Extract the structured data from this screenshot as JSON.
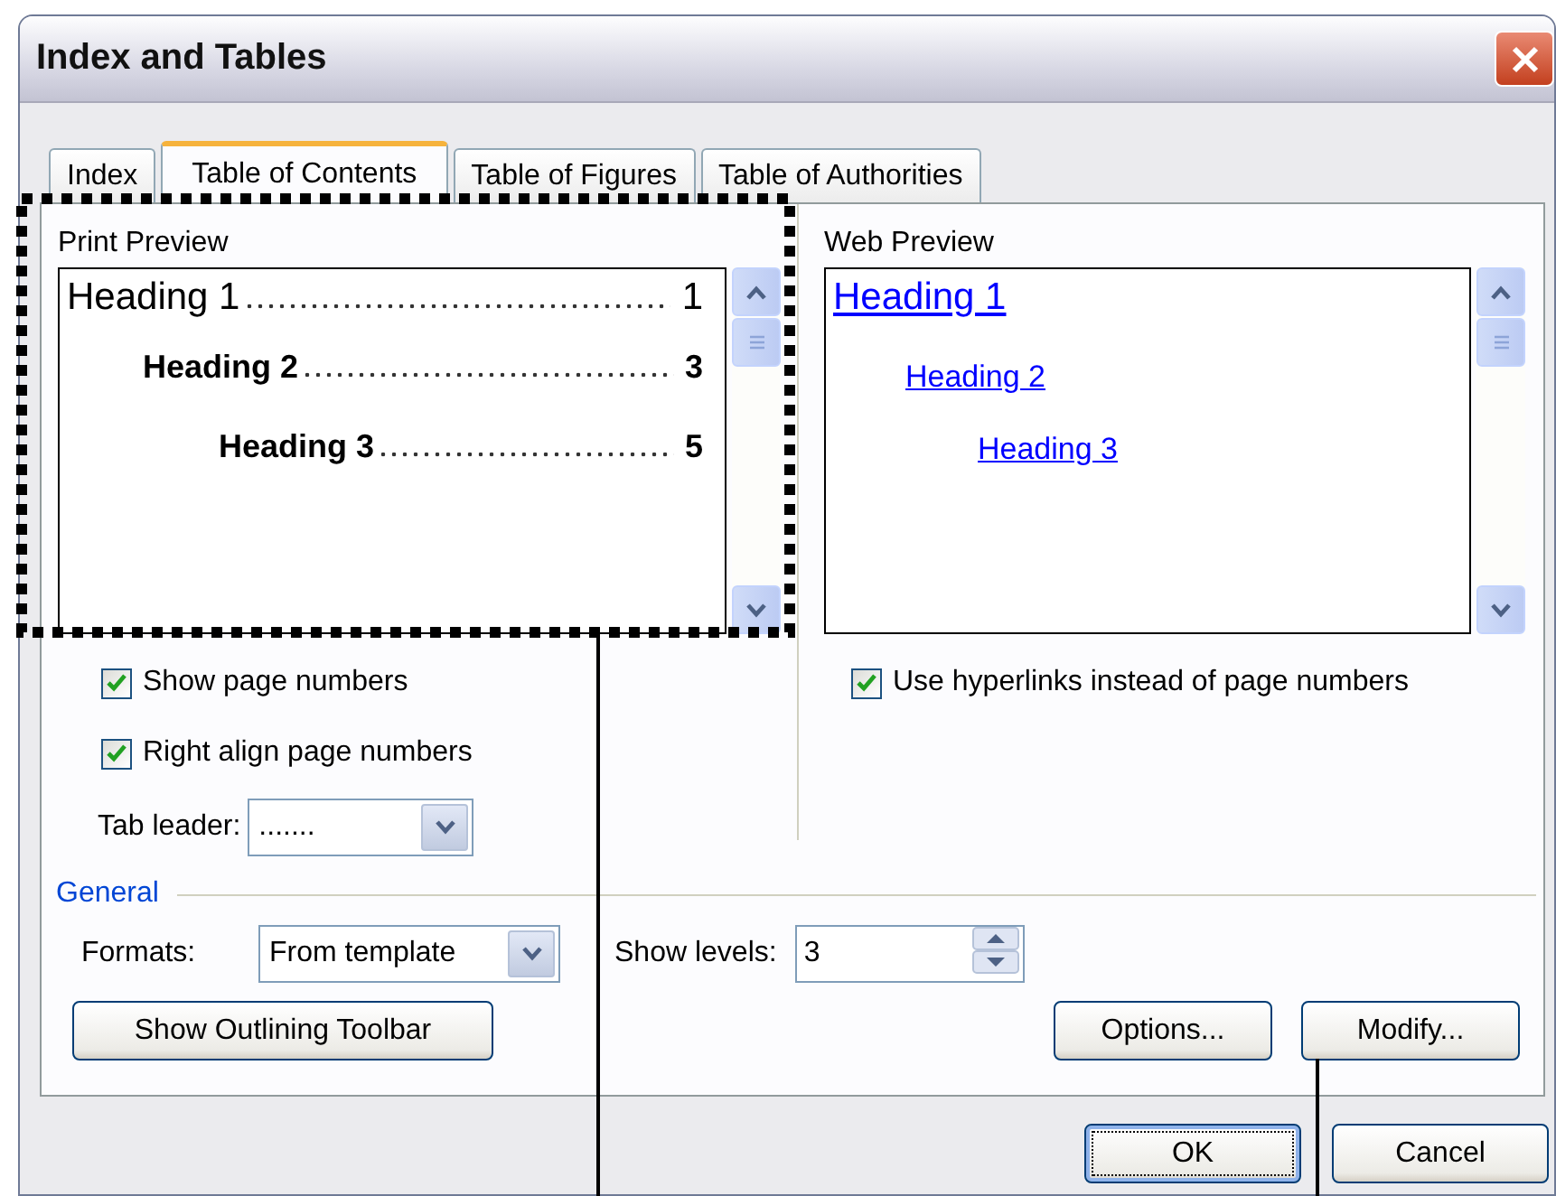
{
  "window": {
    "title": "Index and Tables"
  },
  "tabs": [
    {
      "label": "Index",
      "selected": false
    },
    {
      "label": "Table of Contents",
      "selected": true
    },
    {
      "label": "Table of Figures",
      "selected": false
    },
    {
      "label": "Table of Authorities",
      "selected": false
    }
  ],
  "print_preview": {
    "label": "Print Preview",
    "entries": [
      {
        "text": "Heading 1",
        "page": "1",
        "children": [
          {
            "text": "Heading 2",
            "page": "3",
            "children": [
              {
                "text": "Heading 3",
                "page": "5"
              }
            ]
          }
        ]
      }
    ]
  },
  "web_preview": {
    "label": "Web Preview",
    "entries": [
      {
        "text": "Heading 1",
        "children": [
          {
            "text": "Heading 2",
            "children": [
              {
                "text": "Heading 3"
              }
            ]
          }
        ]
      }
    ]
  },
  "options": [
    {
      "label": "Show page numbers",
      "checked": true
    },
    {
      "label": "Right align page numbers",
      "checked": true
    }
  ],
  "tab_leader": {
    "label": "Tab leader:",
    "value": "......."
  },
  "hyperlinks": {
    "label": "Use hyperlinks instead of page numbers",
    "checked": true
  },
  "general": {
    "title": "General",
    "formats": {
      "label": "Formats:",
      "value": "From template"
    },
    "show_levels": {
      "label": "Show levels:",
      "value": "3"
    }
  },
  "buttons": [
    {
      "label": "Show Outlining Toolbar"
    },
    {
      "label": "Options..."
    },
    {
      "label": "Modify..."
    }
  ],
  "footer_buttons": [
    {
      "label": "OK",
      "default": true
    },
    {
      "label": "Cancel",
      "default": false
    }
  ]
}
